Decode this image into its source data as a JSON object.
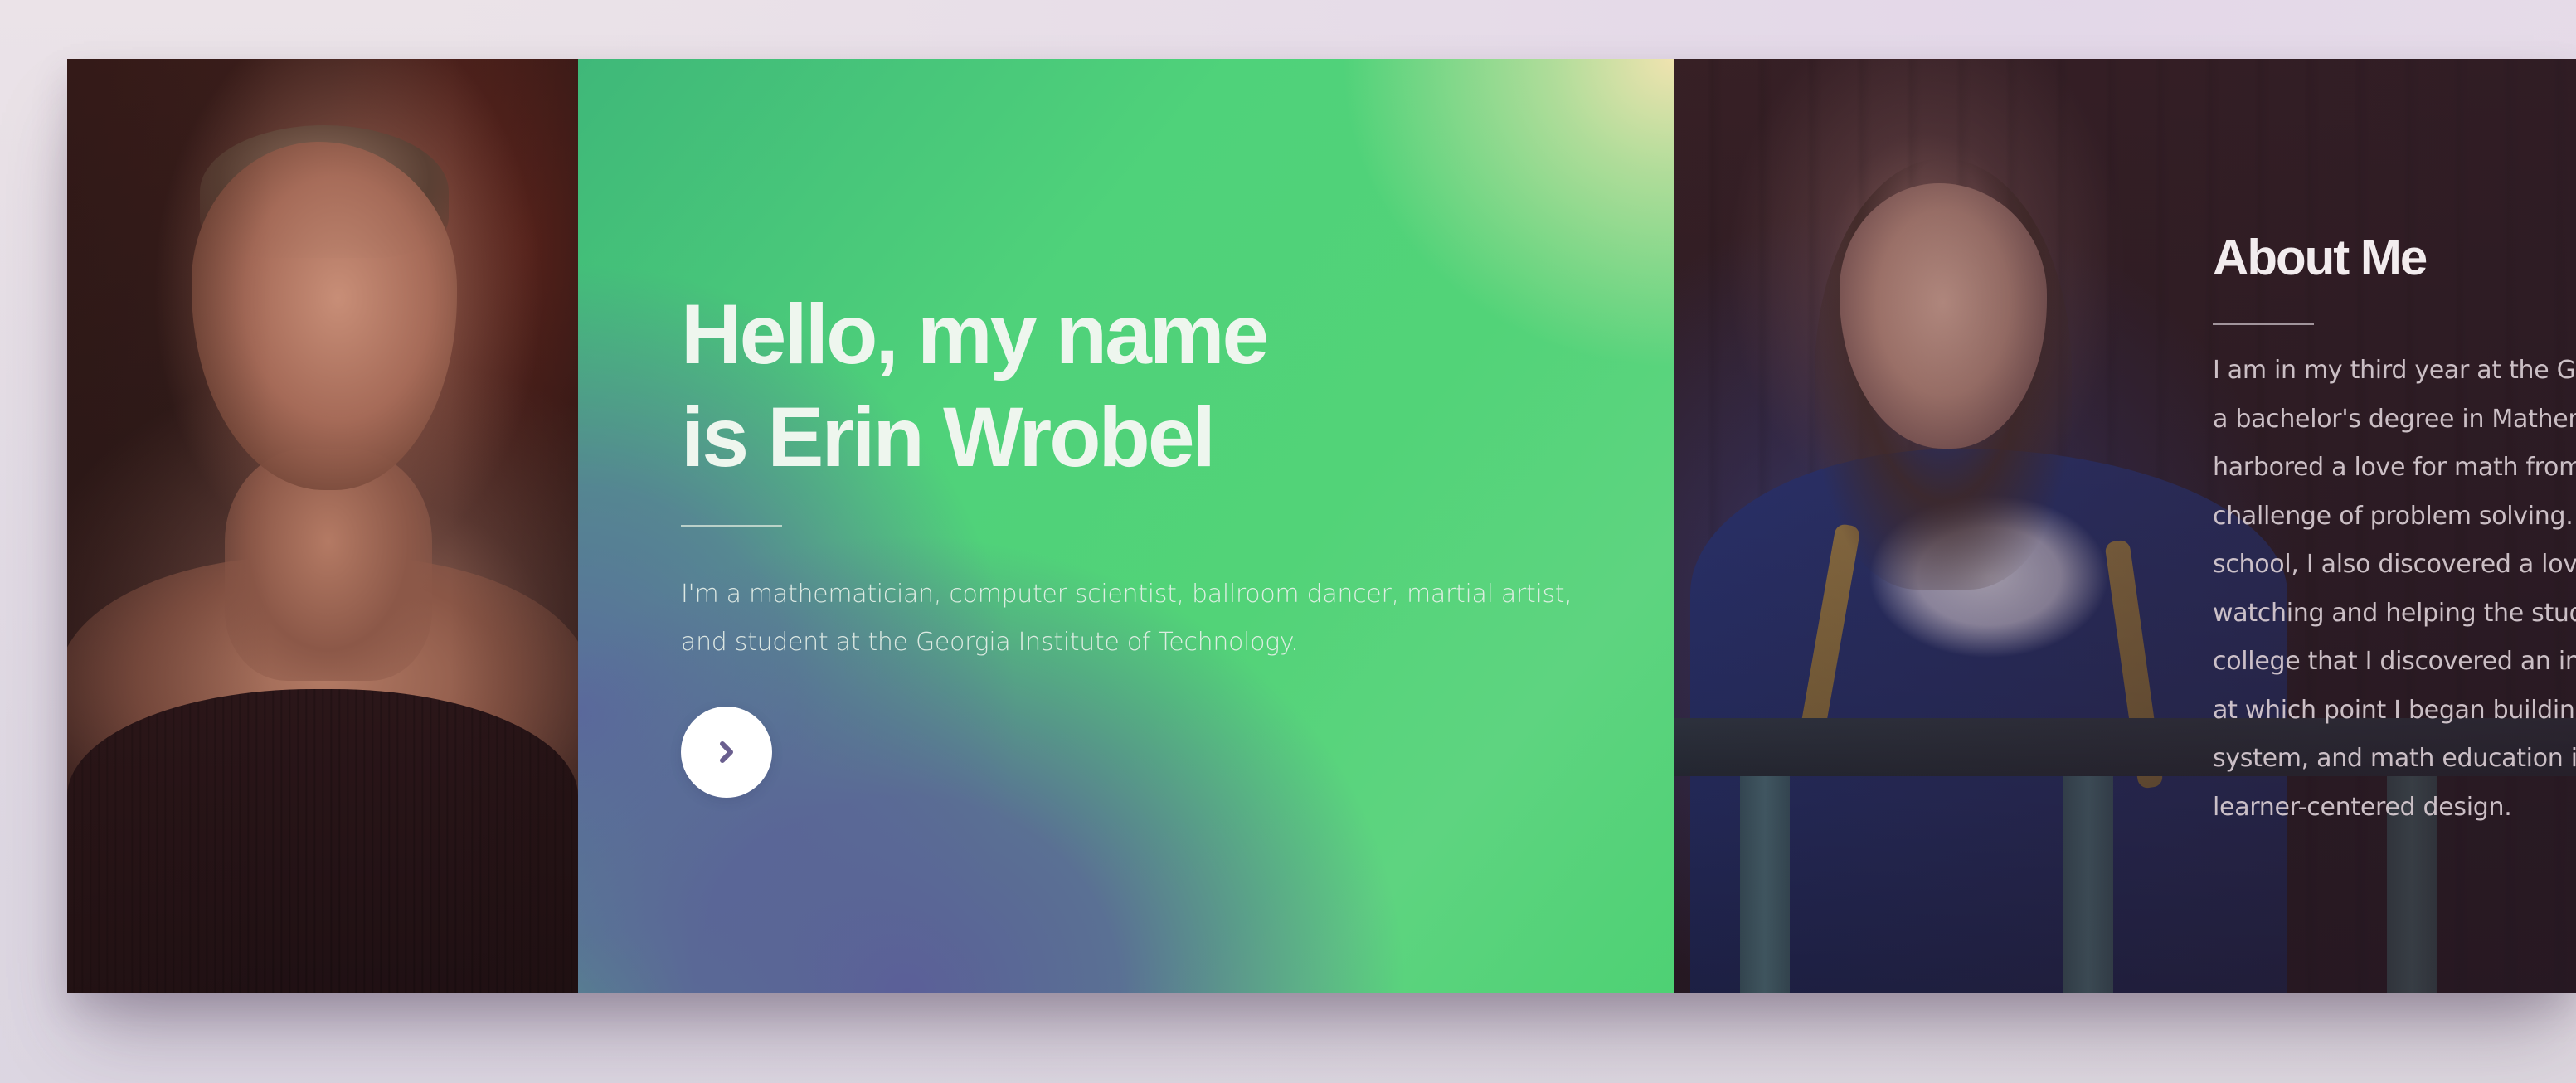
{
  "hero": {
    "title_line1": "Hello, my name",
    "title_line2": "is Erin Wrobel",
    "description_line1": "I'm a mathematician, computer scientist, ballroom dancer, martial artist,",
    "description_line2": "and student at the Georgia Institute of Technology.",
    "next_button_icon": "chevron-right-icon",
    "next_button_icon_color": "#6a5f8f"
  },
  "about": {
    "title": "About Me",
    "lines": [
      "I am in my third year at the Geo",
      "a bachelor's degree in Mathema",
      "harbored a love for math from a",
      "challenge of problem solving. W",
      "school, I also discovered a love",
      "watching and helping the stude",
      "college that I discovered an inte",
      "at which point I began building",
      "system, and math education in",
      "learner-centered design."
    ]
  },
  "colors": {
    "hero_green": "#4fd27a",
    "hero_purple": "#5b5f98",
    "hero_cream": "#f0e3b0",
    "button_bg": "#ffffff"
  }
}
